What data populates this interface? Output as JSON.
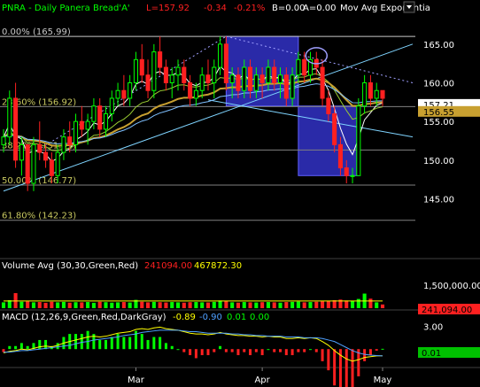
{
  "header": {
    "symbol_text": "PNRA - Daily  Panera Bread'A'",
    "last": "L=157.92",
    "change": "-0.34",
    "pct": "-0.21%",
    "b": "B=0.00",
    "a": "A=0.00",
    "study": "Mov Avg Exponentia"
  },
  "colors": {
    "background": "#000000",
    "up": "#00ff00",
    "down": "#ff2020",
    "grid": "#c8c8c8",
    "fib": "#808080",
    "ma_fast": "#ffffff",
    "ma_mid": "#9acd32",
    "ma_slow": "#c8a030",
    "ma_long": "#7fc0ff",
    "box_fill": "#2a2aa8",
    "trend": "#7fd4ff",
    "macd_line": "#ffff00",
    "macd_signal": "#4fa0ff"
  },
  "chart_data": [
    {
      "type": "candlestick",
      "title": "PNRA - Daily  Panera Bread'A'",
      "ylim": [
        137.5,
        167.5
      ],
      "yticks": [
        145.0,
        150.0,
        155.0,
        160.0,
        165.0
      ],
      "ytick_labels": [
        "145.00",
        "150.00",
        "155.00",
        "160.00",
        "165.00"
      ],
      "xticks": [
        {
          "i": 22,
          "label": "Mar"
        },
        {
          "i": 43,
          "label": "Apr"
        },
        {
          "i": 63,
          "label": "May"
        }
      ],
      "fib_levels": [
        {
          "label": "0.00% (165.99)",
          "value": 165.99
        },
        {
          "label": "23.60% (156.92)",
          "value": 156.92
        },
        {
          "label": "38.20% (151.31)",
          "value": 151.31
        },
        {
          "label": "50.00% (146.77)",
          "value": 146.77
        },
        {
          "label": "61.80% (142.23)",
          "value": 142.23
        }
      ],
      "price_tags": [
        {
          "label": "157.21",
          "value": 157.21,
          "bg": "#ffffff",
          "fg": "#000000"
        },
        {
          "label": "156.55",
          "value": 156.3,
          "bg": "#c8a030",
          "fg": "#000000"
        }
      ],
      "boxes": [
        {
          "i0": 37,
          "i1": 49,
          "v0": 157.0,
          "v1": 166.0
        },
        {
          "i0": 49,
          "i1": 59,
          "v0": 148.0,
          "v1": 157.0
        }
      ],
      "ellipse": {
        "i": 52,
        "v": 163.5
      },
      "trendlines": [
        {
          "i0": 0,
          "v0": 146.0,
          "i1": 68,
          "v1": 165.0,
          "style": "solid"
        },
        {
          "i0": 34,
          "v0": 157.8,
          "i1": 68,
          "v1": 153.0,
          "style": "solid"
        },
        {
          "i0": 37,
          "v0": 166.0,
          "i1": 68,
          "v1": 160.0,
          "style": "dotted"
        },
        {
          "i0": 5,
          "v0": 151.0,
          "i1": 37,
          "v1": 166.0,
          "style": "dotted"
        }
      ],
      "candles": [
        [
          152,
          154,
          151,
          153
        ],
        [
          153,
          159,
          152,
          158
        ],
        [
          158,
          160,
          149,
          150
        ],
        [
          150,
          153,
          148,
          152
        ],
        [
          152,
          152,
          146,
          147
        ],
        [
          147,
          153,
          146,
          152
        ],
        [
          152,
          155,
          150,
          151
        ],
        [
          151,
          152,
          149,
          150
        ],
        [
          150,
          151,
          147,
          148
        ],
        [
          148,
          152,
          147,
          151
        ],
        [
          151,
          154,
          150,
          153
        ],
        [
          153,
          155,
          151,
          152
        ],
        [
          152,
          156,
          151,
          155
        ],
        [
          155,
          157,
          153,
          154
        ],
        [
          154,
          156,
          152,
          155
        ],
        [
          155,
          158,
          154,
          157
        ],
        [
          157,
          158,
          153,
          154
        ],
        [
          154,
          157,
          153,
          156
        ],
        [
          156,
          159,
          155,
          158
        ],
        [
          158,
          160,
          157,
          159
        ],
        [
          159,
          161,
          157,
          158
        ],
        [
          158,
          161,
          157,
          160
        ],
        [
          160,
          164,
          159,
          163
        ],
        [
          163,
          165,
          160,
          161
        ],
        [
          161,
          163,
          158,
          159
        ],
        [
          159,
          165,
          158,
          164
        ],
        [
          164,
          166,
          161,
          162
        ],
        [
          162,
          163,
          159,
          160
        ],
        [
          160,
          162,
          158,
          161
        ],
        [
          161,
          163,
          159,
          162
        ],
        [
          162,
          163,
          159,
          160
        ],
        [
          160,
          161,
          157,
          158
        ],
        [
          158,
          160,
          157,
          159
        ],
        [
          159,
          162,
          158,
          161
        ],
        [
          161,
          163,
          159,
          160
        ],
        [
          160,
          163,
          158,
          162
        ],
        [
          162,
          166,
          161,
          165
        ],
        [
          165,
          166,
          159,
          160
        ],
        [
          160,
          162,
          158,
          161
        ],
        [
          161,
          162,
          158,
          159
        ],
        [
          159,
          163,
          158,
          162
        ],
        [
          162,
          163,
          158,
          159
        ],
        [
          159,
          162,
          158,
          161
        ],
        [
          161,
          162,
          158,
          160
        ],
        [
          160,
          163,
          159,
          162
        ],
        [
          162,
          163,
          159,
          160
        ],
        [
          160,
          162,
          158,
          161
        ],
        [
          161,
          162,
          157,
          158
        ],
        [
          158,
          162,
          157,
          161
        ],
        [
          161,
          164,
          160,
          163
        ],
        [
          163,
          164,
          160,
          161
        ],
        [
          161,
          164,
          160,
          163
        ],
        [
          163,
          164,
          161,
          162
        ],
        [
          162,
          163,
          157,
          158
        ],
        [
          158,
          159,
          155,
          156
        ],
        [
          156,
          157,
          151,
          152
        ],
        [
          152,
          153,
          148,
          149
        ],
        [
          149,
          150,
          147,
          148
        ],
        [
          148,
          149,
          147,
          148
        ],
        [
          148,
          158,
          148,
          157
        ],
        [
          157,
          161,
          156,
          160
        ],
        [
          160,
          161,
          157,
          158
        ],
        [
          158,
          160,
          157,
          159
        ],
        [
          159,
          159,
          157,
          158
        ]
      ],
      "overlays": [
        {
          "name": "fast",
          "color": "#ffffff",
          "period": 5
        },
        {
          "name": "mid",
          "color": "#9acd32",
          "period": 14
        },
        {
          "name": "slow",
          "color": "#c8a030",
          "period": 25
        },
        {
          "name": "long",
          "color": "#7fc0ff",
          "period": 35
        }
      ]
    },
    {
      "type": "bar",
      "title_text": "Volume Avg (30,30,Green,Red)",
      "value1": "241094.00",
      "value2": "467872.30",
      "ytick_labels": [
        "1,500,000.00"
      ],
      "tag": "241,094.00",
      "values": [
        380000,
        520000,
        980000,
        420000,
        450000,
        380000,
        400000,
        350000,
        420000,
        380000,
        410000,
        360000,
        390000,
        380000,
        400000,
        350000,
        420000,
        390000,
        360000,
        380000,
        400000,
        370000,
        540000,
        420000,
        380000,
        410000,
        390000,
        370000,
        400000,
        380000,
        360000,
        390000,
        400000,
        380000,
        370000,
        410000,
        500000,
        460000,
        380000,
        360000,
        400000,
        380000,
        370000,
        390000,
        400000,
        380000,
        360000,
        400000,
        410000,
        430000,
        380000,
        400000,
        420000,
        450000,
        480000,
        520000,
        560000,
        500000,
        460000,
        600000,
        950000,
        620000,
        380000,
        241094
      ]
    },
    {
      "type": "macd",
      "title_text": "MACD (12,26,9,Green,Red,DarkGray)",
      "macd": "-0.89",
      "signal": "-0.90",
      "hist": "0.01",
      "zero": "0.00",
      "ytick_labels": [
        "3.00"
      ],
      "tag": "0.01",
      "macd_values": [
        -0.5,
        -0.3,
        -0.2,
        0.0,
        -0.1,
        0.1,
        0.3,
        0.4,
        0.3,
        0.5,
        0.8,
        1.0,
        1.2,
        1.4,
        1.6,
        1.7,
        1.6,
        1.7,
        1.9,
        2.1,
        2.2,
        2.3,
        2.6,
        2.7,
        2.6,
        2.8,
        2.9,
        2.7,
        2.6,
        2.5,
        2.3,
        2.1,
        2.0,
        2.0,
        1.9,
        2.0,
        2.2,
        2.0,
        1.9,
        1.8,
        1.8,
        1.7,
        1.7,
        1.6,
        1.7,
        1.6,
        1.6,
        1.4,
        1.4,
        1.5,
        1.4,
        1.5,
        1.4,
        1.0,
        0.5,
        -0.2,
        -0.8,
        -1.3,
        -1.6,
        -1.4,
        -1.1,
        -1.0,
        -0.9,
        -0.89
      ],
      "signal_values": [
        -0.4,
        -0.4,
        -0.3,
        -0.2,
        -0.2,
        -0.1,
        0.0,
        0.1,
        0.2,
        0.3,
        0.4,
        0.5,
        0.7,
        0.9,
        1.0,
        1.2,
        1.3,
        1.4,
        1.5,
        1.6,
        1.8,
        1.9,
        2.0,
        2.2,
        2.3,
        2.4,
        2.5,
        2.5,
        2.5,
        2.5,
        2.4,
        2.3,
        2.3,
        2.2,
        2.1,
        2.1,
        2.1,
        2.1,
        2.0,
        2.0,
        1.9,
        1.9,
        1.8,
        1.8,
        1.7,
        1.7,
        1.7,
        1.6,
        1.6,
        1.6,
        1.5,
        1.5,
        1.5,
        1.4,
        1.2,
        1.0,
        0.6,
        0.2,
        -0.2,
        -0.5,
        -0.7,
        -0.8,
        -0.85,
        -0.9
      ]
    }
  ]
}
